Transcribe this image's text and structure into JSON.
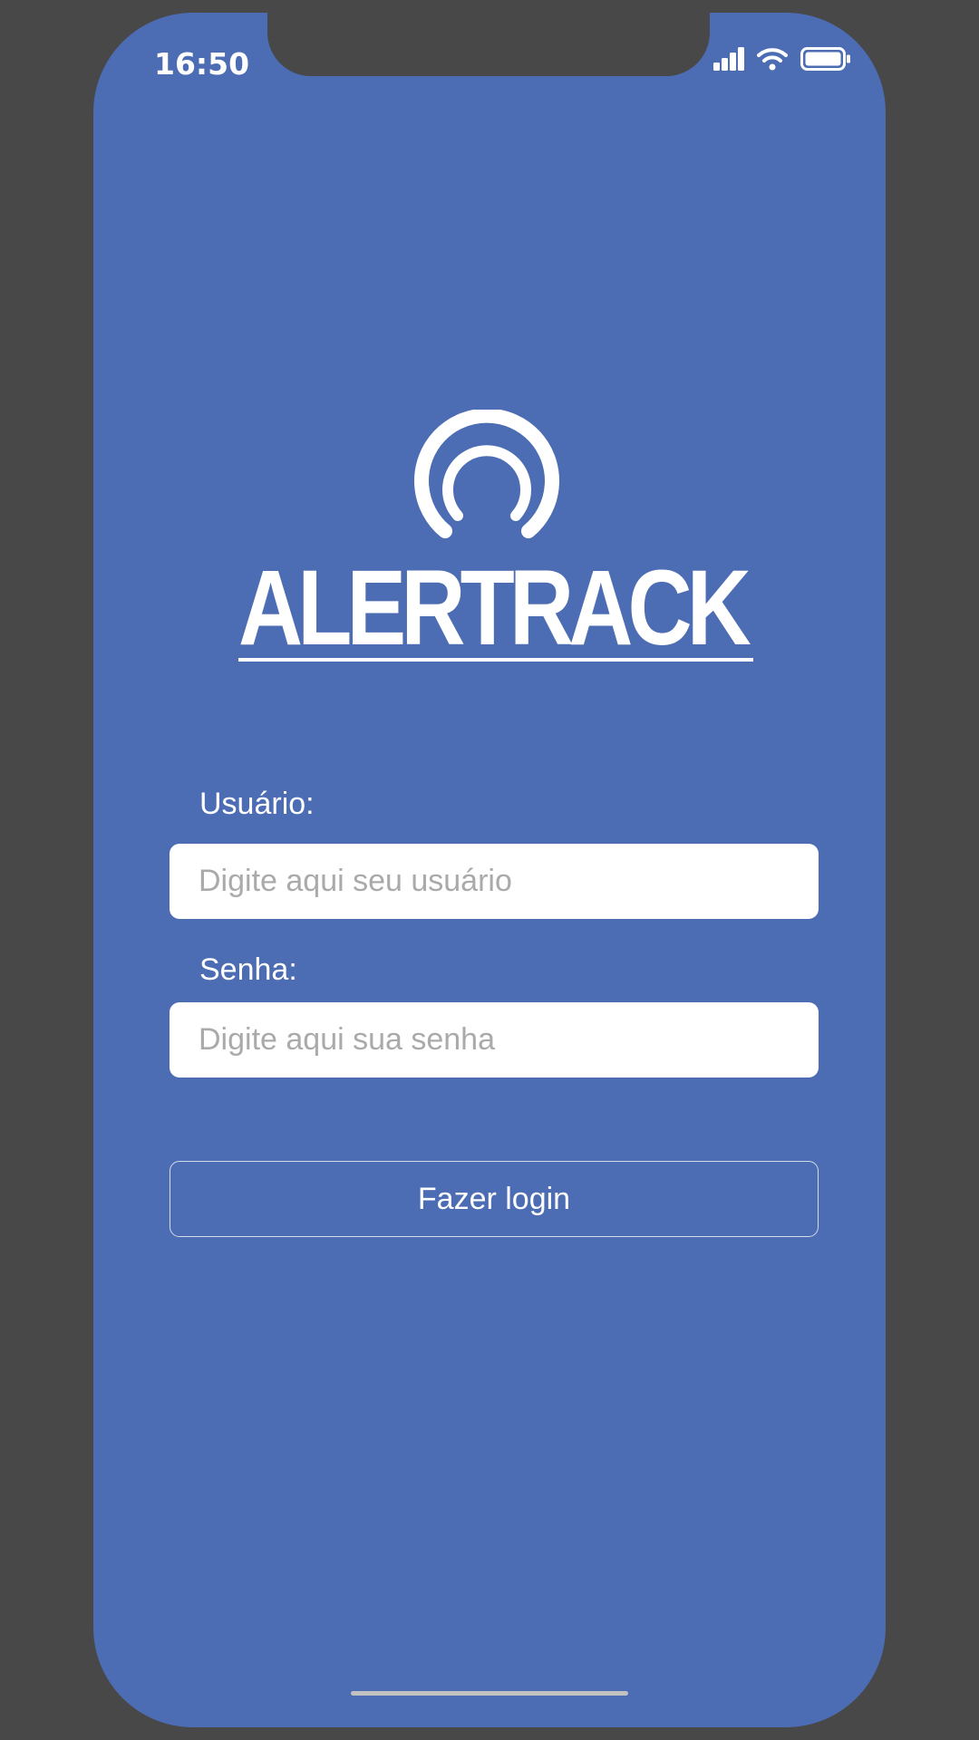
{
  "status_bar": {
    "time": "16:50",
    "icons": [
      "signal-icon",
      "wifi-icon",
      "battery-icon"
    ]
  },
  "logo": {
    "text": "ALERTRACK"
  },
  "form": {
    "user_label": "Usuário:",
    "user_placeholder": "Digite aqui seu usuário",
    "user_value": "",
    "password_label": "Senha:",
    "password_placeholder": "Digite aqui sua senha",
    "password_value": "",
    "login_label": "Fazer login"
  },
  "colors": {
    "background": "#4c6cb3",
    "frame": "#484848",
    "input_bg": "#ffffff",
    "placeholder": "#aaaaaa"
  }
}
